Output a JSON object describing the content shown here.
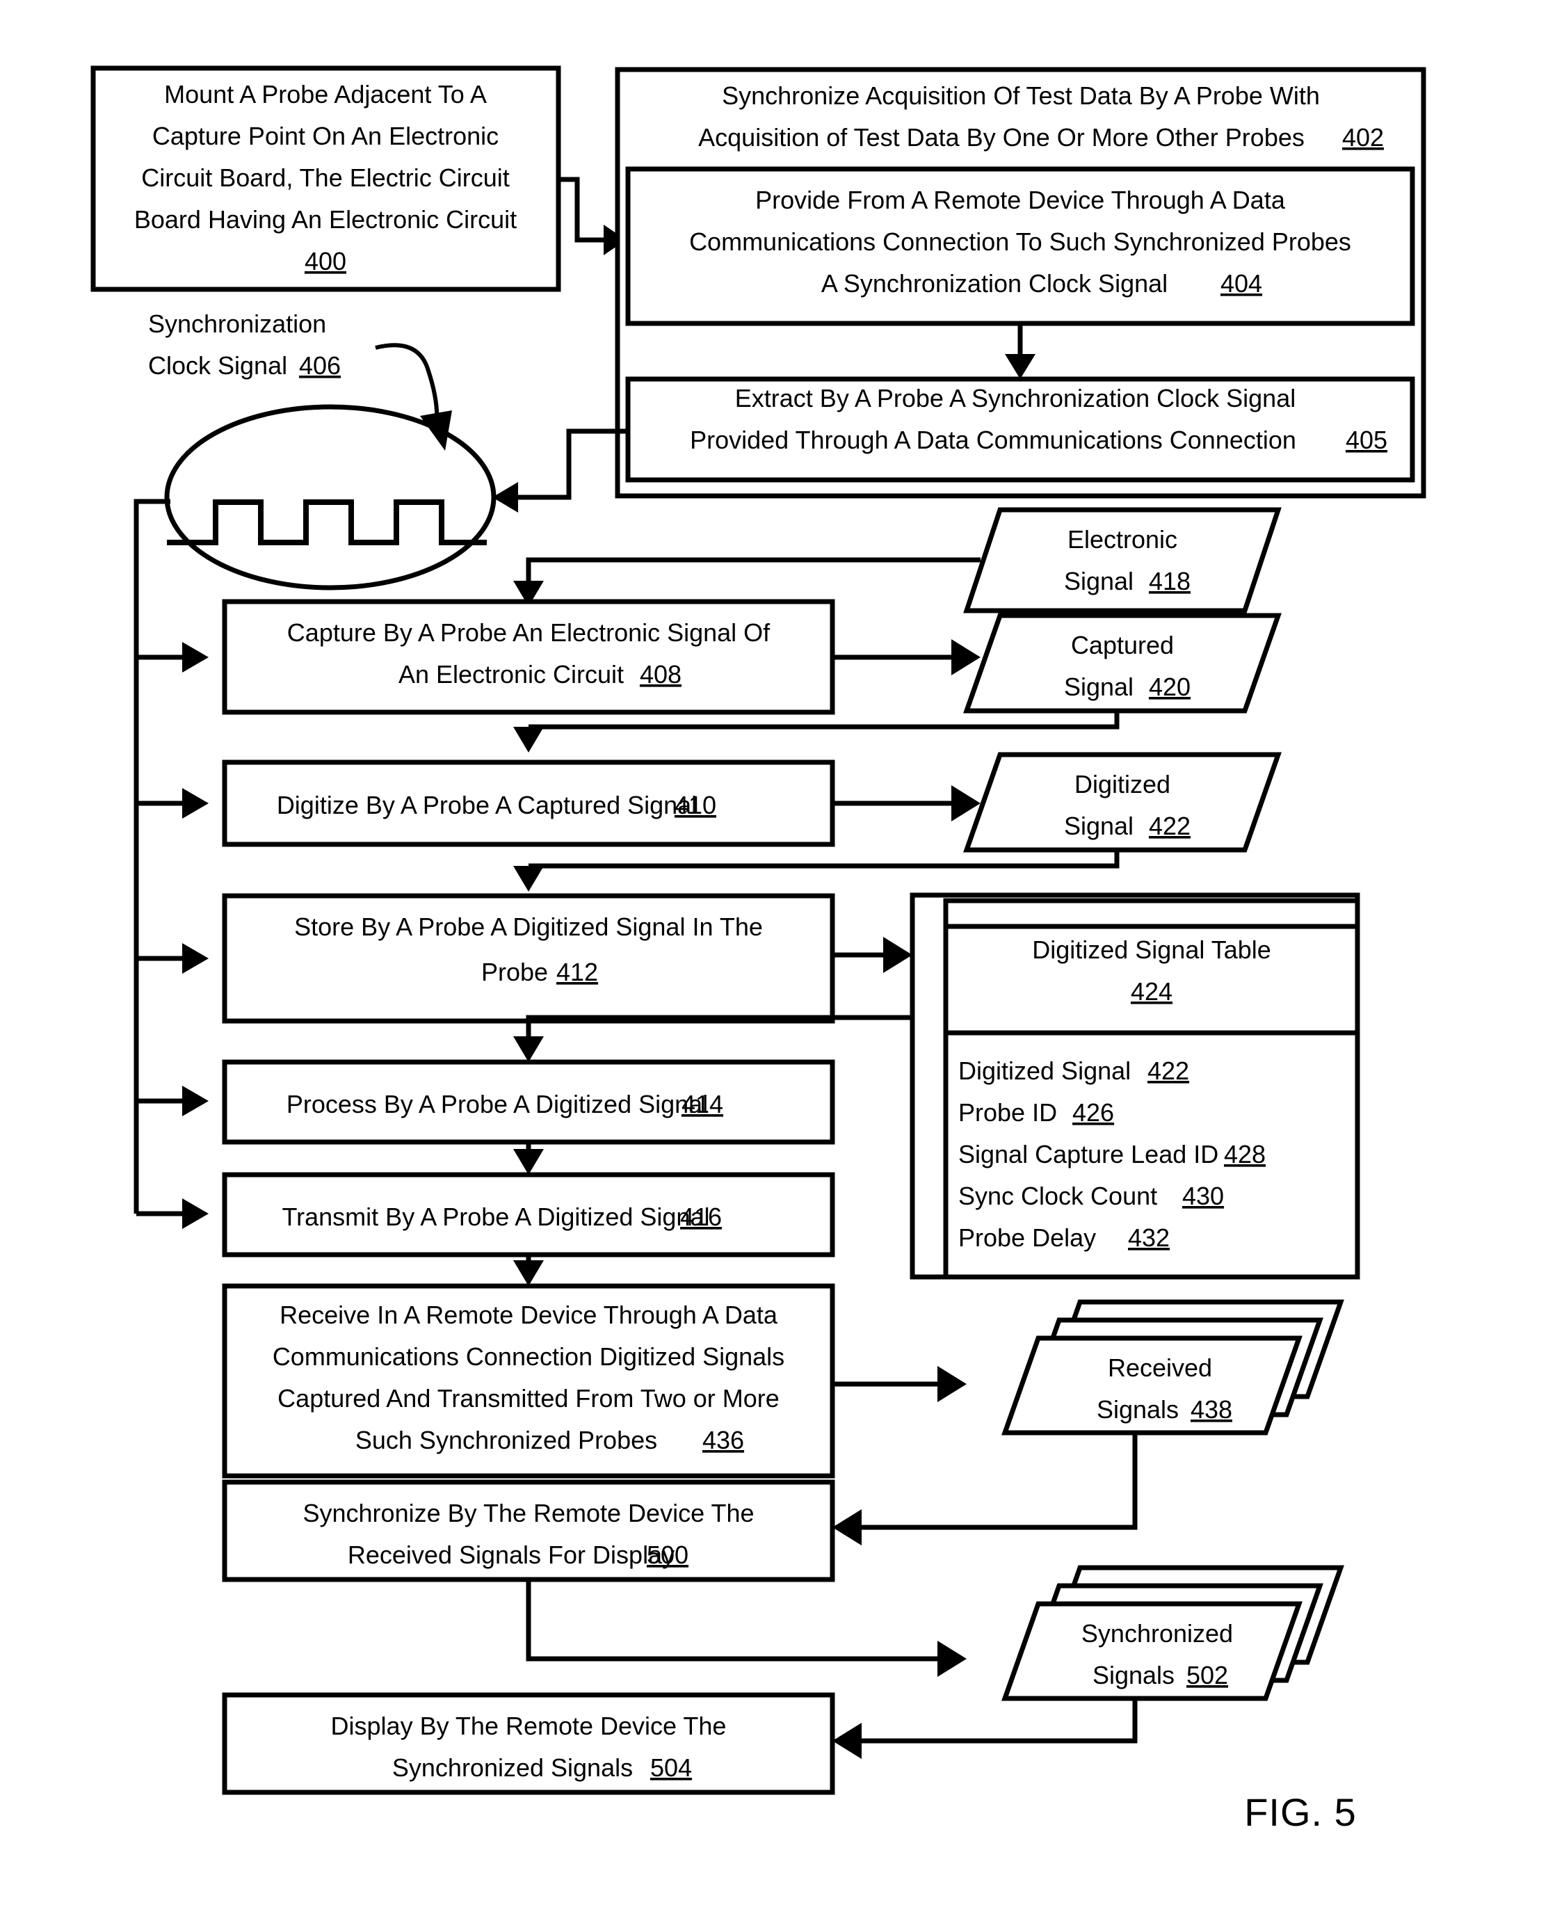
{
  "figure": {
    "label": "FIG. 5"
  },
  "boxes": {
    "b400": {
      "lines": [
        "Mount A Probe Adjacent To A",
        "Capture Point On An Electronic",
        "Circuit Board, The Electric Circuit",
        "Board Having An Electronic Circuit"
      ],
      "ref": "400"
    },
    "b402": {
      "lines": [
        "Synchronize Acquisition Of Test Data By A Probe With",
        "Acquisition of Test Data By One Or More Other Probes"
      ],
      "ref": "402"
    },
    "b404": {
      "lines": [
        "Provide From A Remote Device Through A Data",
        "Communications Connection To Such Synchronized Probes",
        "A Synchronization Clock Signal"
      ],
      "ref": "404"
    },
    "b405": {
      "lines": [
        "Extract By A Probe A Synchronization Clock Signal",
        "Provided Through A Data Communications Connection"
      ],
      "ref": "405"
    },
    "b408": {
      "lines": [
        "Capture By A Probe An Electronic Signal Of",
        "An Electronic Circuit"
      ],
      "ref": "408"
    },
    "b410": {
      "lines": [
        "Digitize By A Probe A Captured Signal"
      ],
      "ref": "410"
    },
    "b412": {
      "lines": [
        "Store By A Probe A Digitized Signal In The",
        "Probe"
      ],
      "ref": "412"
    },
    "b414": {
      "lines": [
        "Process By A Probe A Digitized Signal"
      ],
      "ref": "414"
    },
    "b416": {
      "lines": [
        "Transmit By A Probe A Digitized Signal"
      ],
      "ref": "416"
    },
    "b436": {
      "lines": [
        "Receive In A Remote Device Through A Data",
        "Communications Connection Digitized Signals",
        "Captured And Transmitted From Two or More",
        "Such Synchronized Probes"
      ],
      "ref": "436"
    },
    "b500": {
      "lines": [
        "Synchronize By The Remote Device The",
        "Received Signals For Display"
      ],
      "ref": "500"
    },
    "b504": {
      "lines": [
        "Display By The Remote Device The",
        "Synchronized Signals"
      ],
      "ref": "504"
    }
  },
  "annotations": {
    "clock_signal": {
      "lines": [
        "Synchronization",
        "Clock Signal"
      ],
      "ref": "406"
    }
  },
  "data_objects": {
    "d418": {
      "lines": [
        "Electronic",
        "Signal"
      ],
      "ref": "418"
    },
    "d420": {
      "lines": [
        "Captured",
        "Signal"
      ],
      "ref": "420"
    },
    "d422": {
      "lines": [
        "Digitized",
        "Signal"
      ],
      "ref": "422"
    },
    "d438": {
      "lines": [
        "Received",
        "Signals"
      ],
      "ref": "438"
    },
    "d502": {
      "lines": [
        "Synchronized",
        "Signals"
      ],
      "ref": "502"
    }
  },
  "table": {
    "title": "Digitized Signal Table",
    "title_ref": "424",
    "fields": [
      {
        "name": "Digitized Signal",
        "ref": "422"
      },
      {
        "name": "Probe ID",
        "ref": "426"
      },
      {
        "name": "Signal Capture Lead ID",
        "ref": "428"
      },
      {
        "name": "Sync Clock Count",
        "ref": "430"
      },
      {
        "name": "Probe Delay",
        "ref": "432"
      }
    ]
  },
  "colors": {
    "stroke": "#000000",
    "background": "#ffffff"
  }
}
